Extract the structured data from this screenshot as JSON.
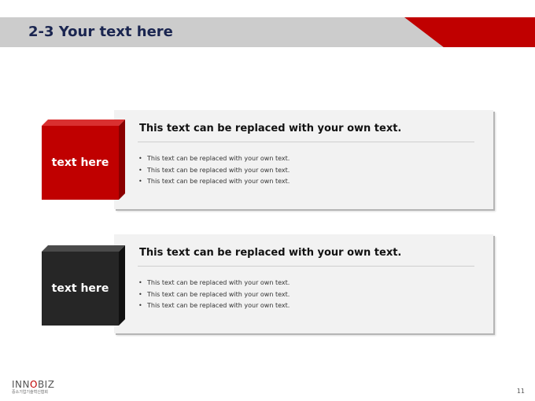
{
  "header": {
    "title": "2-3 Your text here"
  },
  "blocks": [
    {
      "label": "text here",
      "heading": "This text can be replaced with your own text.",
      "bullets": [
        "This text can be replaced with your own text.",
        "This text can be replaced with your own text.",
        "This text can be replaced with your own text."
      ],
      "color": "#c00000"
    },
    {
      "label": "text here",
      "heading": "This text can be replaced with your own text.",
      "bullets": [
        "This text can be replaced with your own text.",
        "This text can be replaced with your own text.",
        "This text can be replaced with your own text."
      ],
      "color": "#262626"
    }
  ],
  "footer": {
    "logo_prefix": "INN",
    "logo_o": "O",
    "logo_suffix": "BIZ",
    "logo_subtitle": "중소기업기술혁신협회",
    "page_number": "11"
  },
  "colors": {
    "accent": "#c00000",
    "header_gray": "#cccccc",
    "title": "#1a2550"
  }
}
